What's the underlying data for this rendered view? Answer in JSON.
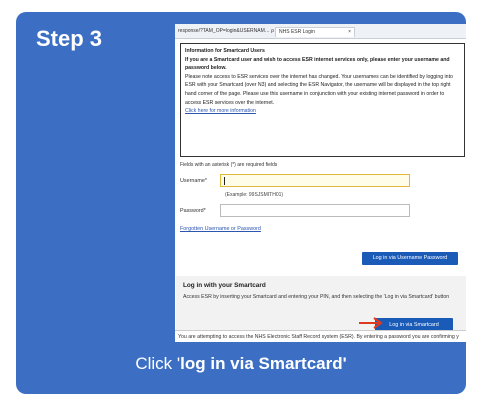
{
  "step": {
    "title": "Step 3"
  },
  "browser": {
    "url": "response/?TAM_OP=login&USERNAM…  ρ ▾ 🔒 C",
    "tab_label": "NHS ESR Login",
    "tab_close": "×"
  },
  "info_box": {
    "heading": "Information for Smartcard Users",
    "intro": "If you are a Smartcard user and wish to access ESR internet services only, please enter your username and password below.",
    "body": "Please note access to ESR services over the internet has changed. Your usernames can be identified by logging into ESR with your Smartcard (over N3) and selecting the ESR Navigator, the username will be displayed in the top right hand corner of the page. Please use this username in conjunction with your existing internet password in order to access ESR services over the internet.",
    "link": "Click here for more information"
  },
  "form": {
    "required_note": "Fields with an asterisk (*) are required fields",
    "username_label": "Username*",
    "username_example": "(Example: 99SJSMITH01)",
    "password_label": "Password*",
    "forgot_link": "Forgotten Username or Password",
    "login_up_button": "Log in via Username Password"
  },
  "smartcard": {
    "title": "Log in with your Smartcard",
    "description": "Access ESR by inserting your Smartcard and entering your PIN, and then selecting the 'Log in via Smartcard' button",
    "button": "Log in via Smartcard",
    "arrow_color": "#e03a1e"
  },
  "footer_text": "You are attempting to access the NHS Electronic Staff Record system (ESR). By entering a password you are confirming y",
  "instruction": {
    "prefix": "Click '",
    "bold": "log in via Smartcard'"
  },
  "colors": {
    "card_bg": "#3c6fc4",
    "button_blue": "#1a5bb8"
  }
}
